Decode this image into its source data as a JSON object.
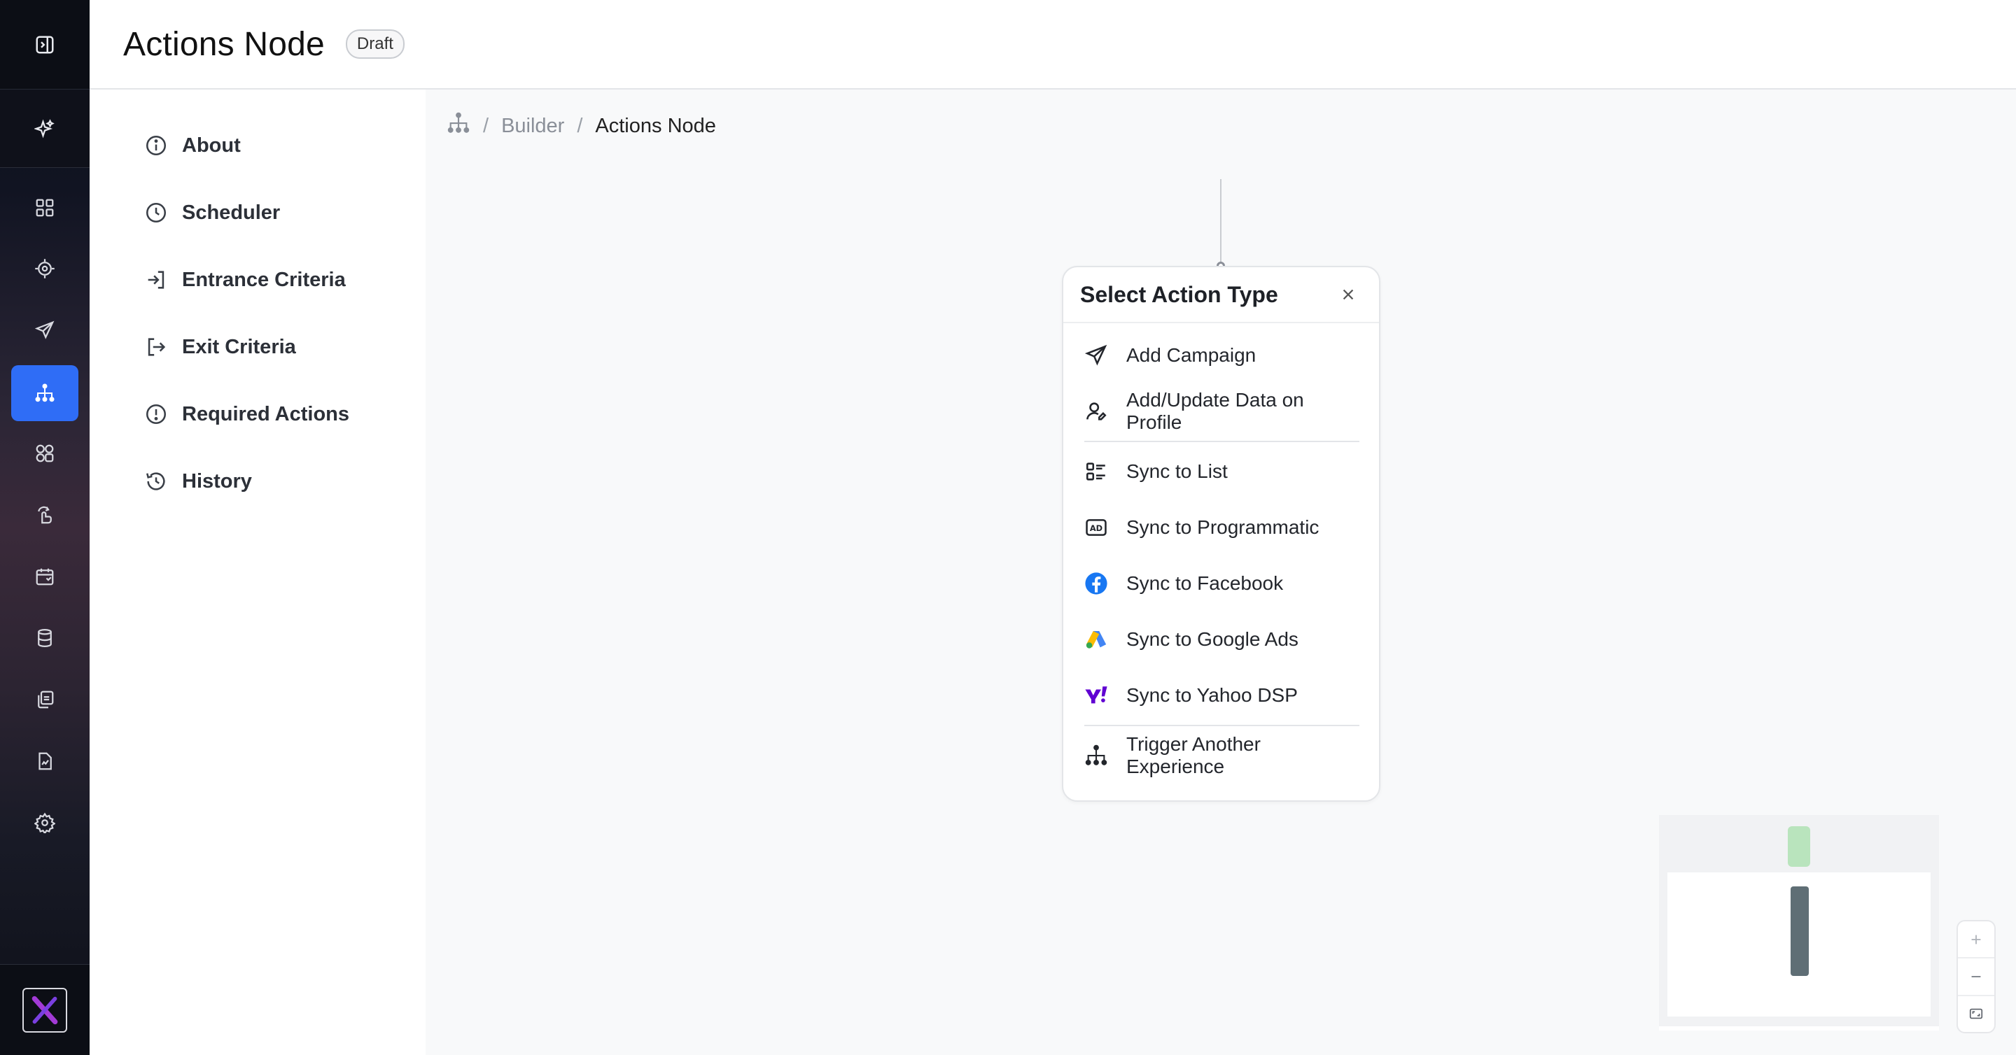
{
  "header": {
    "title": "Actions Node",
    "status_badge": "Draft"
  },
  "rail": {
    "items": [
      {
        "icon": "sparkle-icon"
      },
      {
        "icon": "dashboard-grid-icon"
      },
      {
        "icon": "target-icon"
      },
      {
        "icon": "send-icon"
      },
      {
        "icon": "journey-tree-icon",
        "active": true
      },
      {
        "icon": "segments-icon"
      },
      {
        "icon": "hand-point-icon"
      },
      {
        "icon": "calendar-icon"
      },
      {
        "icon": "database-icon"
      },
      {
        "icon": "copy-stack-icon"
      },
      {
        "icon": "report-icon"
      },
      {
        "icon": "settings-gear-icon"
      }
    ],
    "accent": "#2f6df6"
  },
  "subnav": {
    "items": [
      {
        "label": "About",
        "icon": "info-icon"
      },
      {
        "label": "Scheduler",
        "icon": "clock-icon"
      },
      {
        "label": "Entrance Criteria",
        "icon": "sign-in-icon"
      },
      {
        "label": "Exit Criteria",
        "icon": "sign-out-icon"
      },
      {
        "label": "Required Actions",
        "icon": "alert-circle-icon"
      },
      {
        "label": "History",
        "icon": "history-icon"
      }
    ]
  },
  "breadcrumb": {
    "separator": "/",
    "items": [
      "Builder",
      "Actions Node"
    ]
  },
  "action_panel": {
    "title": "Select Action Type",
    "items": [
      {
        "label": "Add Campaign",
        "icon": "send-icon"
      },
      {
        "label": "Add/Update Data on Profile",
        "icon": "user-edit-icon"
      },
      {
        "label": "Sync to List",
        "icon": "list-icon"
      },
      {
        "label": "Sync to Programmatic",
        "icon": "ad-icon"
      },
      {
        "label": "Sync to Facebook",
        "icon": "facebook-icon"
      },
      {
        "label": "Sync to Google Ads",
        "icon": "google-ads-icon"
      },
      {
        "label": "Sync to Yahoo DSP",
        "icon": "yahoo-icon"
      },
      {
        "label": "Trigger Another Experience",
        "icon": "journey-tree-icon"
      }
    ]
  },
  "zoom": {
    "in": "+",
    "out": "−"
  }
}
